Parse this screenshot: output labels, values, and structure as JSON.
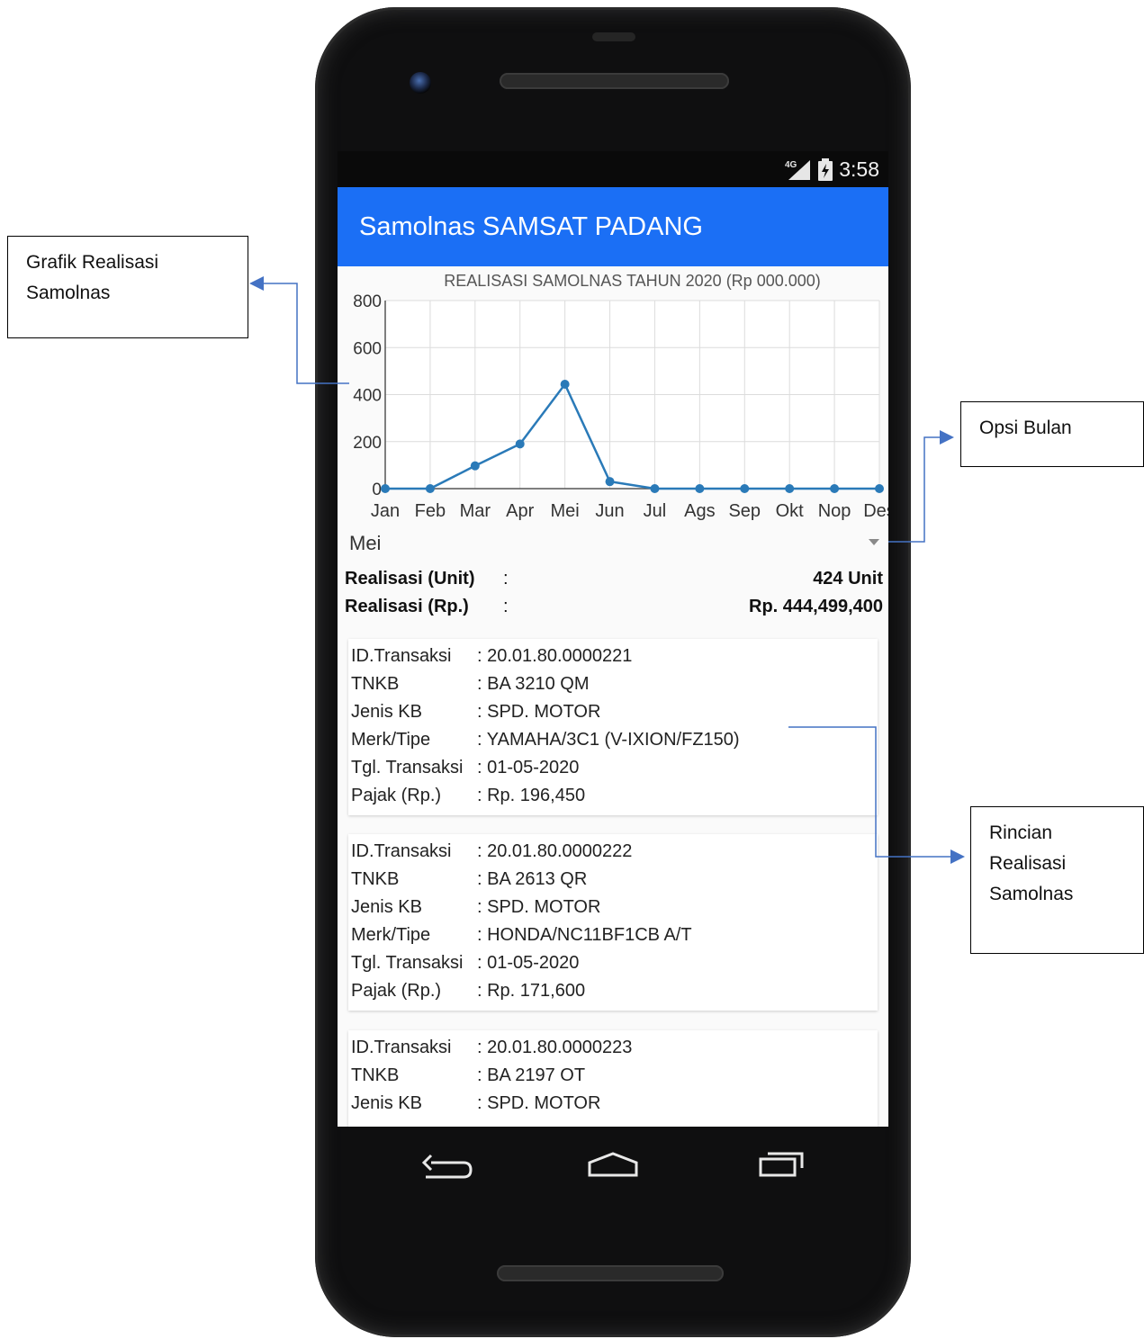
{
  "status_bar": {
    "network": "4G",
    "time": "3:58"
  },
  "app": {
    "title": "Samolnas SAMSAT PADANG"
  },
  "chart_data": {
    "type": "line",
    "title": "REALISASI SAMOLNAS TAHUN 2020 (Rp 000.000)",
    "categories": [
      "Jan",
      "Feb",
      "Mar",
      "Apr",
      "Mei",
      "Jun",
      "Jul",
      "Ags",
      "Sep",
      "Okt",
      "Nop",
      "Des"
    ],
    "series": [
      {
        "values": [
          0,
          0,
          97,
          190,
          444,
          30,
          0,
          0,
          0,
          0,
          0,
          0
        ]
      }
    ],
    "ylim": [
      0,
      800
    ],
    "yticks": [
      0,
      200,
      400,
      600,
      800
    ],
    "grid": true,
    "line_color": "#2a7ab8"
  },
  "month_select": {
    "selected": "Mei"
  },
  "summary": {
    "unit_label": "Realisasi (Unit)",
    "unit_colon": ":",
    "unit_value": "424 Unit",
    "rp_label": "Realisasi (Rp.)",
    "rp_colon": ":",
    "rp_value": "Rp. 444,499,400"
  },
  "transactions": [
    {
      "rows": [
        {
          "k": "ID.Transaksi",
          "v": ": 20.01.80.0000221"
        },
        {
          "k": "TNKB",
          "v": ": BA 3210 QM"
        },
        {
          "k": "Jenis KB",
          "v": ": SPD. MOTOR"
        },
        {
          "k": "Merk/Tipe",
          "v": ": YAMAHA/3C1 (V-IXION/FZ150)"
        },
        {
          "k": "Tgl. Transaksi",
          "v": ": 01-05-2020"
        },
        {
          "k": "Pajak (Rp.)",
          "v": ": Rp. 196,450"
        }
      ]
    },
    {
      "rows": [
        {
          "k": "ID.Transaksi",
          "v": ": 20.01.80.0000222"
        },
        {
          "k": "TNKB",
          "v": ": BA 2613 QR"
        },
        {
          "k": "Jenis KB",
          "v": ": SPD. MOTOR"
        },
        {
          "k": "Merk/Tipe",
          "v": ": HONDA/NC11BF1CB A/T"
        },
        {
          "k": "Tgl. Transaksi",
          "v": ": 01-05-2020"
        },
        {
          "k": "Pajak (Rp.)",
          "v": ": Rp. 171,600"
        }
      ]
    },
    {
      "rows": [
        {
          "k": "ID.Transaksi",
          "v": ": 20.01.80.0000223"
        },
        {
          "k": "TNKB",
          "v": ": BA 2197 OT"
        },
        {
          "k": "Jenis KB",
          "v": ": SPD. MOTOR"
        }
      ]
    }
  ],
  "annotations": {
    "grafik": [
      "Grafik Realisasi",
      "Samolnas"
    ],
    "opsi": [
      "Opsi Bulan"
    ],
    "rincian": [
      "Rincian",
      "Realisasi",
      "Samolnas"
    ],
    "arrow_color": "#4472c4"
  },
  "icons": {
    "status": [
      "signal-4g-icon",
      "battery-charging-icon"
    ],
    "nav": [
      "back-icon",
      "home-icon",
      "recent-apps-icon"
    ]
  }
}
